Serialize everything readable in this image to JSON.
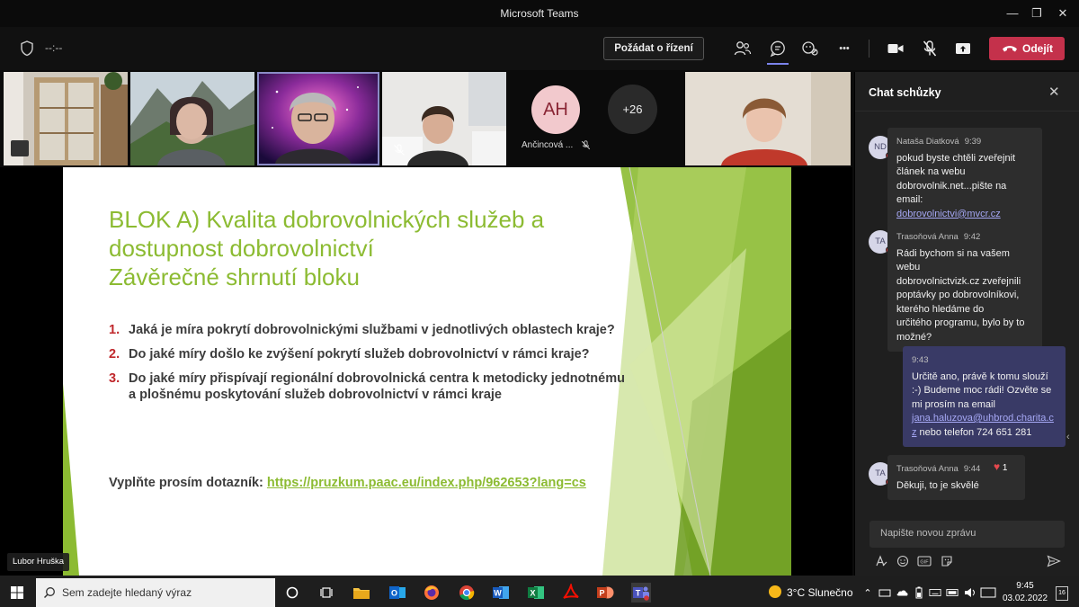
{
  "window": {
    "title": "Microsoft Teams",
    "minimize": "—",
    "maximize": "❐",
    "close": "✕"
  },
  "toolbar": {
    "timer": "--:--",
    "request_control_label": "Požádat o řízení",
    "leave_label": "Odejít",
    "more": "•••"
  },
  "participants": {
    "avatar_initials": "AH",
    "avatar_name": "Ančincová ...",
    "more_count": "+26",
    "presenter_name": "Lubor Hruška"
  },
  "slide": {
    "title_lines": [
      "BLOK A) Kvalita dobrovolnických služeb a",
      "dostupnost dobrovolnictví",
      "Závěrečné shrnutí bloku"
    ],
    "questions": [
      {
        "num": "1.",
        "text": "Jaká je míra pokrytí dobrovolnickými službami v jednotlivých oblastech kraje?"
      },
      {
        "num": "2.",
        "text": "Do jaké míry došlo ke zvýšení pokrytí služeb dobrovolnictví v rámci kraje?"
      },
      {
        "num": "3.",
        "text": "Do jaké míry přispívají regionální dobrovolnická centra k metodicky jednotnému a plošnému poskytování služeb dobrovolnictví v rámci kraje"
      }
    ],
    "survey_label": "Vyplňte prosím dotazník:",
    "survey_url": "https://pruzkum.paac.eu/index.php/962653?lang=cs",
    "colors": {
      "accent_green": "#8cbb32",
      "number_red": "#c0282c",
      "text": "#3d3d3d"
    }
  },
  "chat": {
    "title": "Chat schůzky",
    "messages": [
      {
        "initials": "ND",
        "author": "Nataša Diatková",
        "time": "9:39",
        "lines": [
          "pokud byste chtěli zveřejnit",
          "článek na webu",
          "dobrovolnik.net...pište na email:"
        ],
        "link": "dobrovolnictvi@mvcr.cz"
      },
      {
        "initials": "TA",
        "author": "Trasoňová Anna",
        "time": "9:42",
        "lines": [
          "Rádi bychom si na vašem webu",
          "dobrovolnictvizk.cz zveřejnili",
          "poptávky po dobrovolníkovi,",
          "kterého hledáme do",
          "určitého programu, bylo by to",
          "možné?"
        ]
      },
      {
        "self": true,
        "time": "9:43",
        "lines": [
          "Určitě ano, právě k tomu slouží",
          ":-) Budeme moc rádi! Ozvěte se",
          "mi prosím na email"
        ],
        "link_line1": "jana.haluzova@uhbrod.charita.c",
        "link_line2": "z",
        "tail": " nebo telefon 724 651 281"
      },
      {
        "initials": "TA",
        "author": "Trasoňová Anna",
        "time": "9:44",
        "lines": [
          "Děkuji, to je skvělé"
        ],
        "reaction_count": "1"
      }
    ],
    "compose_placeholder": "Napište novou zprávu"
  },
  "taskbar": {
    "search_placeholder": "Sem zadejte hledaný výraz",
    "weather": "3°C  Slunečno",
    "time": "9:45",
    "date": "03.02.2022",
    "notifications": "16"
  }
}
